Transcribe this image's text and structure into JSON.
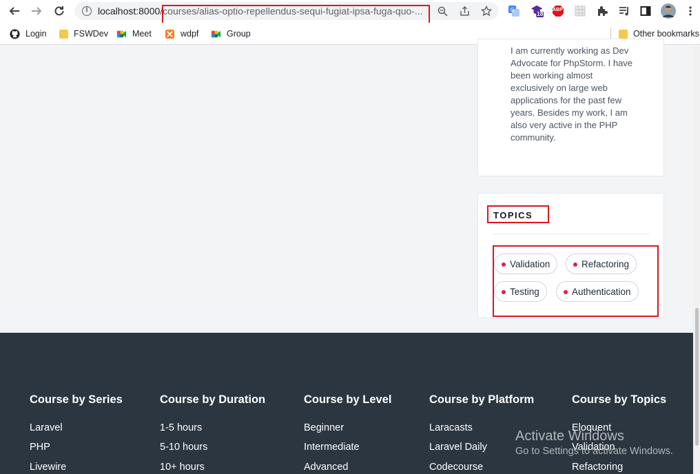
{
  "browser": {
    "url_host": "localhost:8000",
    "url_path": "/courses/alias-optio-repellendus-sequi-fugiat-ipsa-fuga-quo-...",
    "extension_badge": "18",
    "abp_label": "ABP"
  },
  "bookmarks": {
    "items": [
      {
        "label": "Login",
        "icon": "github-icon"
      },
      {
        "label": "FSWDev",
        "icon": "folder-icon"
      },
      {
        "label": "Meet",
        "icon": "meet-icon"
      },
      {
        "label": "wdpf",
        "icon": "xampp-icon"
      },
      {
        "label": "Group",
        "icon": "meet-icon"
      }
    ],
    "other": "Other bookmarks"
  },
  "author": {
    "bio": "I am currently working as Dev Advocate for PhpStorm. I have been working almost exclusively on large web applications for the past few years. Besides my work, I am also very active in the PHP community."
  },
  "topics": {
    "title": "TOPICS",
    "items": [
      "Validation",
      "Refactoring",
      "Testing",
      "Authentication"
    ],
    "dot_color": "#e11d48"
  },
  "footer": {
    "columns": [
      {
        "title": "Course by Series",
        "links": [
          "Laravel",
          "PHP",
          "Livewire"
        ]
      },
      {
        "title": "Course by Duration",
        "links": [
          "1-5 hours",
          "5-10 hours",
          "10+ hours"
        ]
      },
      {
        "title": "Course by Level",
        "links": [
          "Beginner",
          "Intermediate",
          "Advanced"
        ]
      },
      {
        "title": "Course by Platform",
        "links": [
          "Laracasts",
          "Laravel Daily",
          "Codecourse"
        ]
      },
      {
        "title": "Course by Topics",
        "links": [
          "Eloquent",
          "Validation",
          "Refactoring"
        ]
      }
    ],
    "background": "#2c3640"
  },
  "watermark": {
    "line1": "Activate Windows",
    "line2": "Go to Settings to activate Windows."
  },
  "accent": "#e0141b"
}
